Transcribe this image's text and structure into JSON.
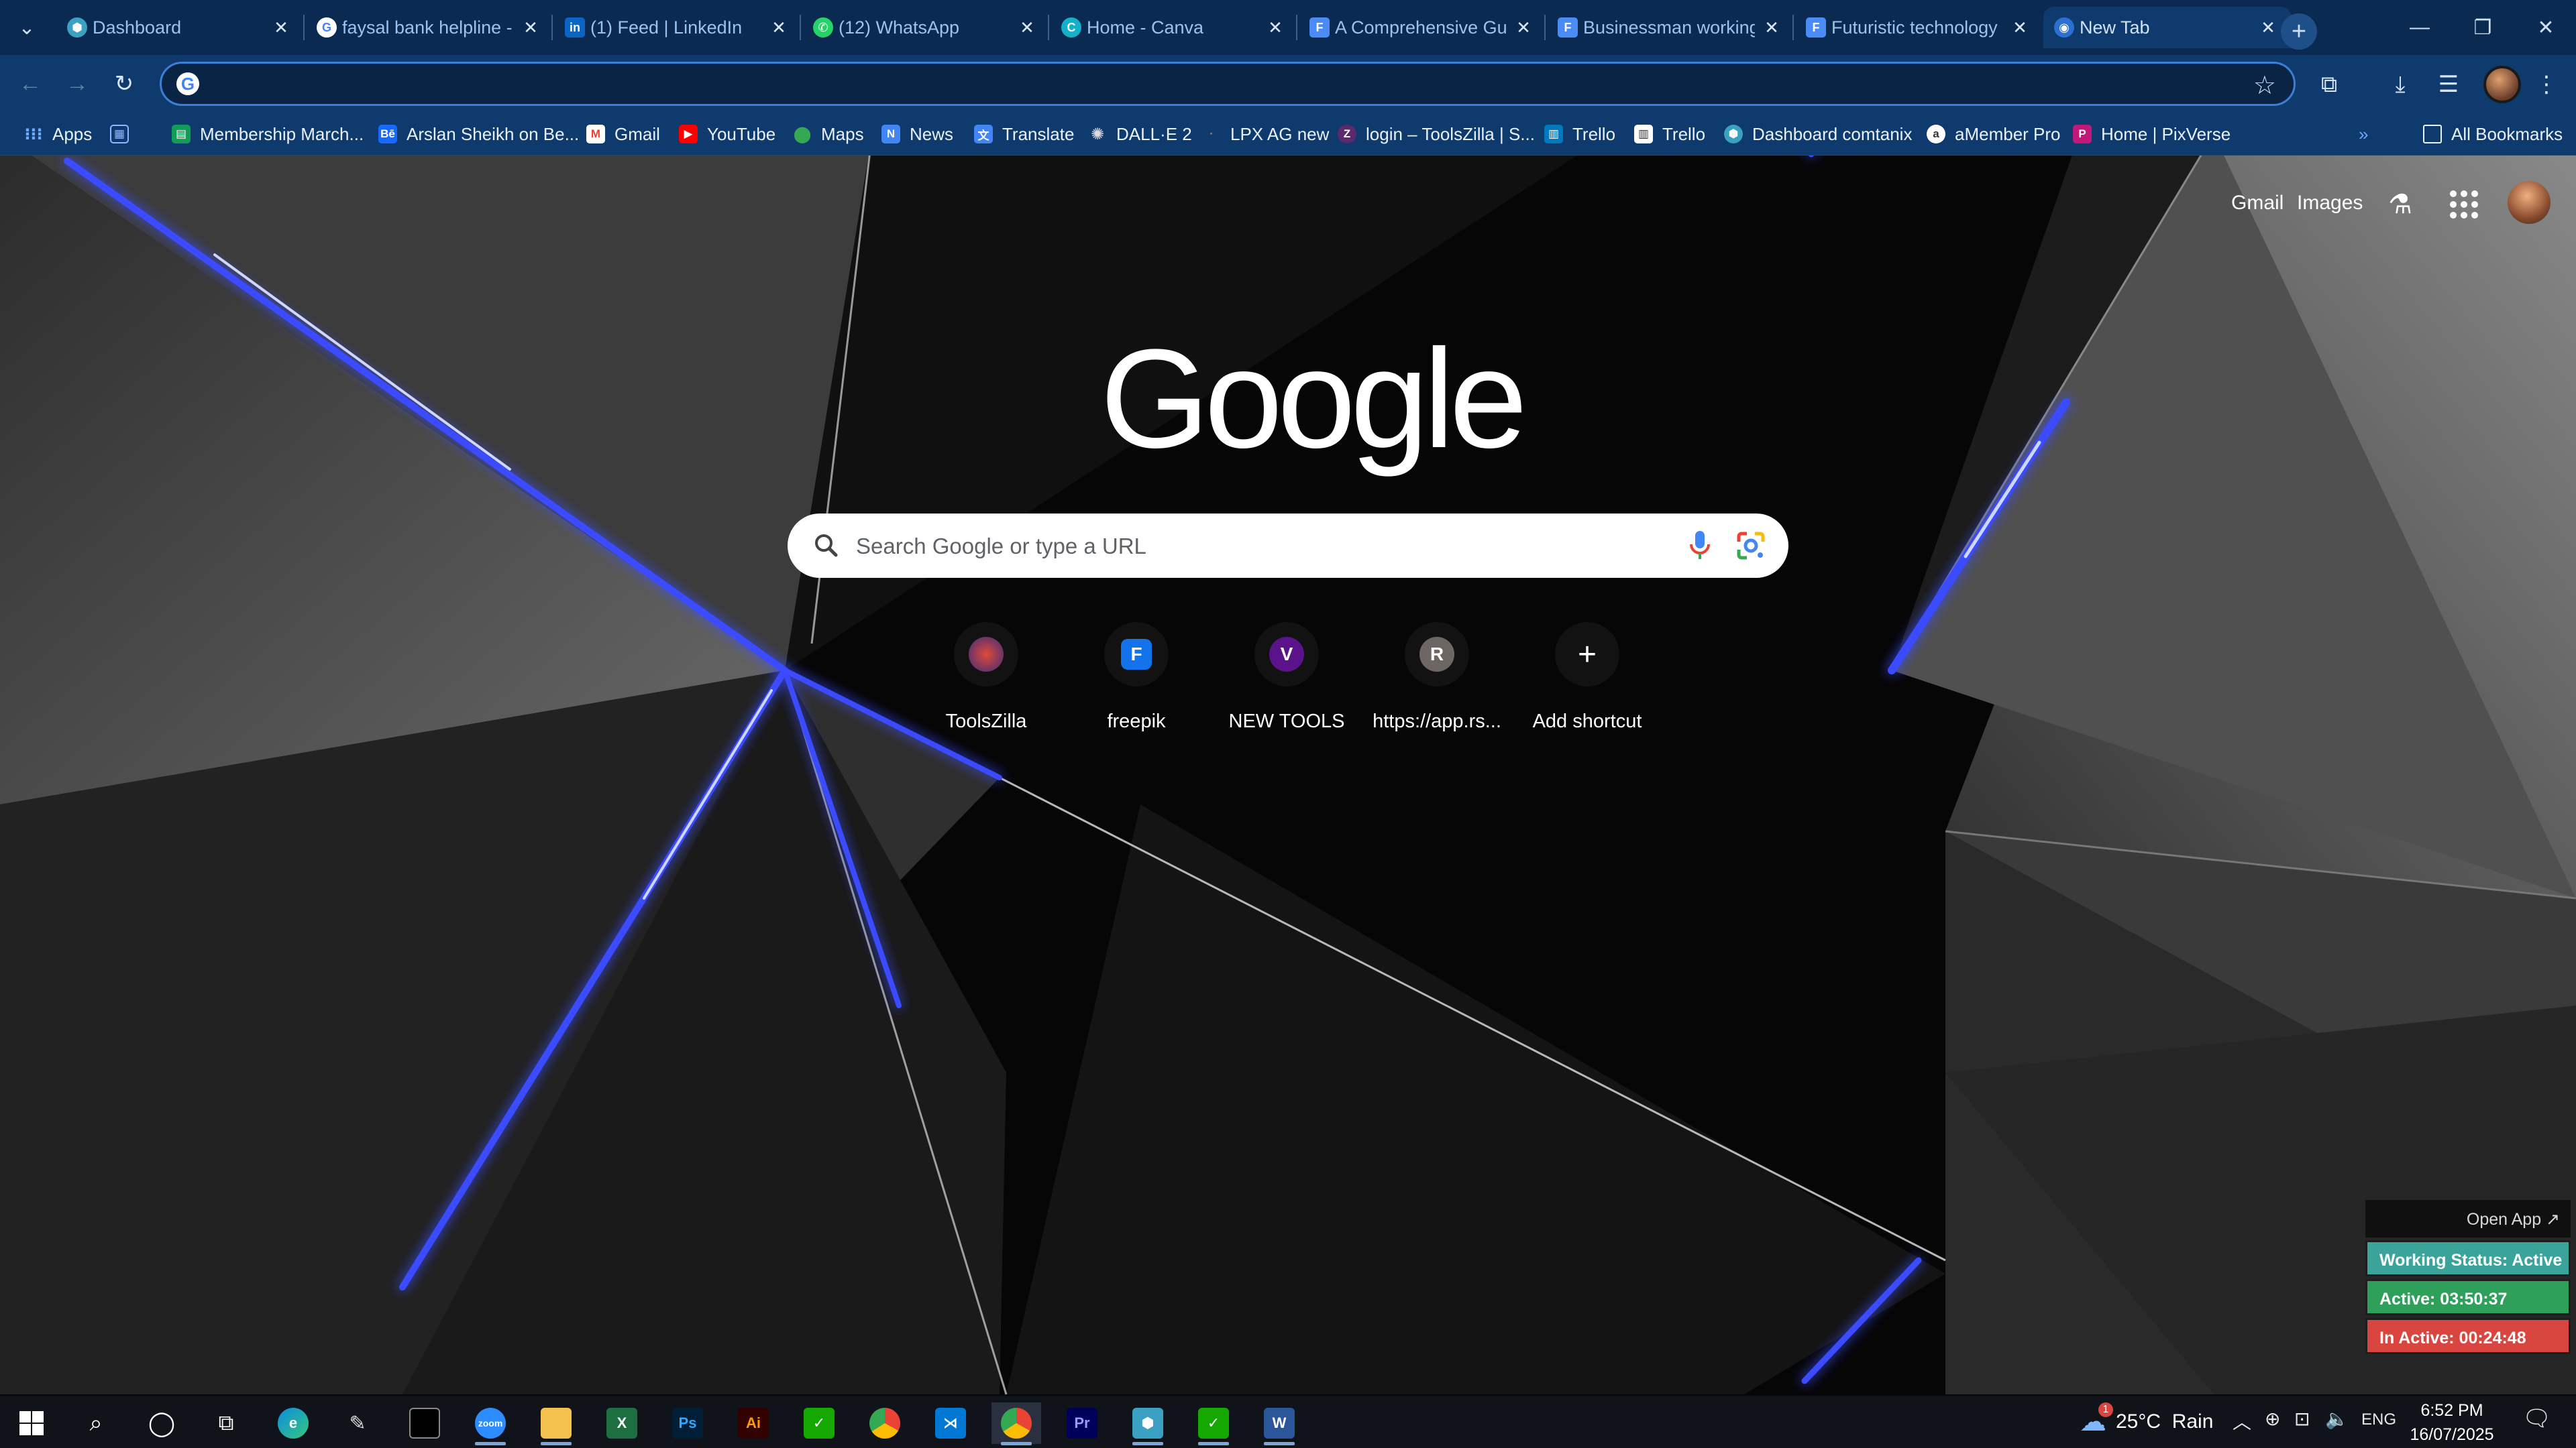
{
  "browser": {
    "tabs": [
      {
        "title": "Dashboard",
        "favicon": "dashboard-hex-icon",
        "active": false
      },
      {
        "title": "faysal bank helpline -",
        "favicon": "google-icon",
        "active": false
      },
      {
        "title": "(1) Feed | LinkedIn",
        "favicon": "linkedin-icon",
        "active": false
      },
      {
        "title": "(12) WhatsApp",
        "favicon": "whatsapp-icon",
        "active": false
      },
      {
        "title": "Home - Canva",
        "favicon": "canva-icon",
        "active": false
      },
      {
        "title": "A Comprehensive Gu",
        "favicon": "docs-icon",
        "active": false
      },
      {
        "title": "Businessman working",
        "favicon": "docs-icon",
        "active": false
      },
      {
        "title": "Futuristic technology",
        "favicon": "docs-icon",
        "active": false
      },
      {
        "title": "New Tab",
        "favicon": "chrome-icon",
        "active": true
      }
    ],
    "new_tab_glyph": "+",
    "omnibox": {
      "value": "",
      "placeholder": ""
    },
    "bookmarks": [
      {
        "label": "Apps",
        "icon": "apps-grid-icon"
      },
      {
        "label": "",
        "icon": "tab-groups-icon"
      },
      {
        "label": "Membership March...",
        "icon": "sheets-icon"
      },
      {
        "label": "Arslan Sheikh on Be...",
        "icon": "behance-icon"
      },
      {
        "label": "Gmail",
        "icon": "gmail-icon"
      },
      {
        "label": "YouTube",
        "icon": "youtube-icon"
      },
      {
        "label": "Maps",
        "icon": "maps-icon"
      },
      {
        "label": "News",
        "icon": "news-icon"
      },
      {
        "label": "Translate",
        "icon": "translate-icon"
      },
      {
        "label": "DALL·E 2",
        "icon": "openai-icon"
      },
      {
        "label": "LPX AG new",
        "icon": "lpx-icon"
      },
      {
        "label": "login – ToolsZilla | S...",
        "icon": "toolszilla-icon"
      },
      {
        "label": "Trello",
        "icon": "trello-icon"
      },
      {
        "label": "Trello",
        "icon": "trello-icon"
      },
      {
        "label": "Dashboard comtanix",
        "icon": "dashboard-hex-icon"
      },
      {
        "label": "aMember Pro",
        "icon": "amember-icon"
      },
      {
        "label": "Home | PixVerse",
        "icon": "pixverse-icon"
      }
    ],
    "all_bookmarks_label": "All Bookmarks"
  },
  "ntp": {
    "header_links": [
      "Gmail",
      "Images"
    ],
    "logo_text": "Google",
    "search_placeholder": "Search Google or type a URL",
    "shortcuts": [
      {
        "label": "ToolsZilla",
        "icon": "toolszilla-icon",
        "letter": ""
      },
      {
        "label": "freepik",
        "icon": "freepik-icon",
        "letter": ""
      },
      {
        "label": "NEW TOOLS",
        "icon": "letter-v-icon",
        "letter": "V"
      },
      {
        "label": "https://app.rs...",
        "icon": "letter-r-icon",
        "letter": "R"
      },
      {
        "label": "Add shortcut",
        "icon": "plus-icon",
        "letter": "+"
      }
    ]
  },
  "tracker": {
    "open_app_label": "Open App ↗",
    "working_status": "Working Status: Active",
    "active_time": "Active: 03:50:37",
    "inactive_time": "In Active: 00:24:48",
    "colors": {
      "status": "#3aa39a",
      "active": "#2ea05a",
      "inactive": "#d9463f"
    }
  },
  "taskbar": {
    "weather": "25°C  Rain",
    "weather_badge": "1",
    "language": "ENG",
    "time": "6:52 PM",
    "date": "16/07/2025",
    "apps": [
      "start",
      "search",
      "cortana",
      "task-view",
      "edge",
      "pen",
      "terminal",
      "zoom",
      "file-explorer",
      "excel",
      "photoshop",
      "illustrator",
      "upwork",
      "chrome",
      "vscode",
      "chrome-active",
      "premiere",
      "dashboard-hex",
      "upwork-2",
      "word"
    ]
  }
}
